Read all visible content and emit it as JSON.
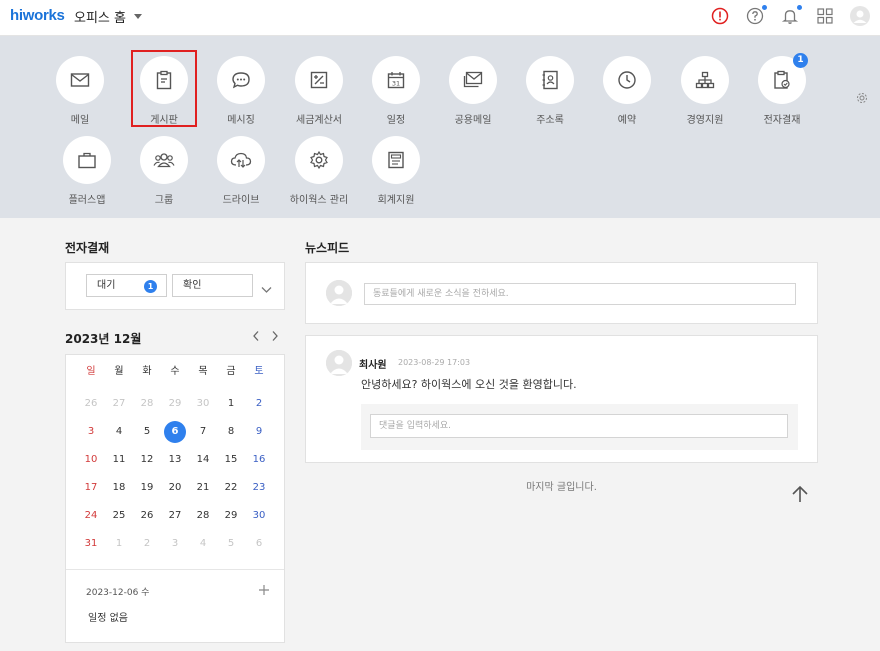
{
  "topbar": {
    "logo": "hiworks",
    "home_title": "오피스 홈"
  },
  "apps": [
    {
      "label": "메일",
      "icon": "mail-icon"
    },
    {
      "label": "게시판",
      "icon": "clipboard-icon"
    },
    {
      "label": "메시징",
      "icon": "chat-icon"
    },
    {
      "label": "세금계산서",
      "icon": "tax-invoice-icon"
    },
    {
      "label": "일정",
      "icon": "calendar-icon"
    },
    {
      "label": "공용메일",
      "icon": "shared-mail-icon"
    },
    {
      "label": "주소록",
      "icon": "address-book-icon"
    },
    {
      "label": "예약",
      "icon": "clock-icon"
    },
    {
      "label": "경영지원",
      "icon": "org-chart-icon"
    },
    {
      "label": "전자결재",
      "icon": "approval-icon",
      "badge": "1"
    },
    {
      "label": "플러스앱",
      "icon": "bag-icon"
    },
    {
      "label": "그룹",
      "icon": "group-icon"
    },
    {
      "label": "드라이브",
      "icon": "cloud-icon"
    },
    {
      "label": "하이웍스 관리",
      "icon": "settings-icon"
    },
    {
      "label": "회계지원",
      "icon": "accounting-icon"
    }
  ],
  "approval": {
    "title": "전자결재",
    "waiting_label": "대기",
    "waiting_count": "1",
    "confirm_label": "확인"
  },
  "calendar": {
    "month_title": "2023년 12월",
    "weekdays": [
      "일",
      "월",
      "화",
      "수",
      "목",
      "금",
      "토"
    ],
    "weeks": [
      [
        "26",
        "27",
        "28",
        "29",
        "30",
        "1",
        "2"
      ],
      [
        "3",
        "4",
        "5",
        "6",
        "7",
        "8",
        "9"
      ],
      [
        "10",
        "11",
        "12",
        "13",
        "14",
        "15",
        "16"
      ],
      [
        "17",
        "18",
        "19",
        "20",
        "21",
        "22",
        "23"
      ],
      [
        "24",
        "25",
        "26",
        "27",
        "28",
        "29",
        "30"
      ],
      [
        "31",
        "1",
        "2",
        "3",
        "4",
        "5",
        "6"
      ]
    ],
    "selected_date": "2023-12-06 수",
    "no_events": "일정 없음"
  },
  "newsfeed": {
    "title": "뉴스피드",
    "compose_placeholder": "동료들에게 새로운 소식을 전하세요.",
    "post": {
      "author": "최사원",
      "time": "2023-08-29 17:03",
      "body": "안녕하세요? 하이웍스에 오신 것을 환영합니다.",
      "comment_placeholder": "댓글을 입력하세요."
    },
    "end_text": "마지막 글입니다."
  },
  "colors": {
    "accent": "#2f80ed",
    "highlight_box": "#e02020",
    "apps_bg": "#dde1e7",
    "page_bg": "#f3f3f3"
  }
}
